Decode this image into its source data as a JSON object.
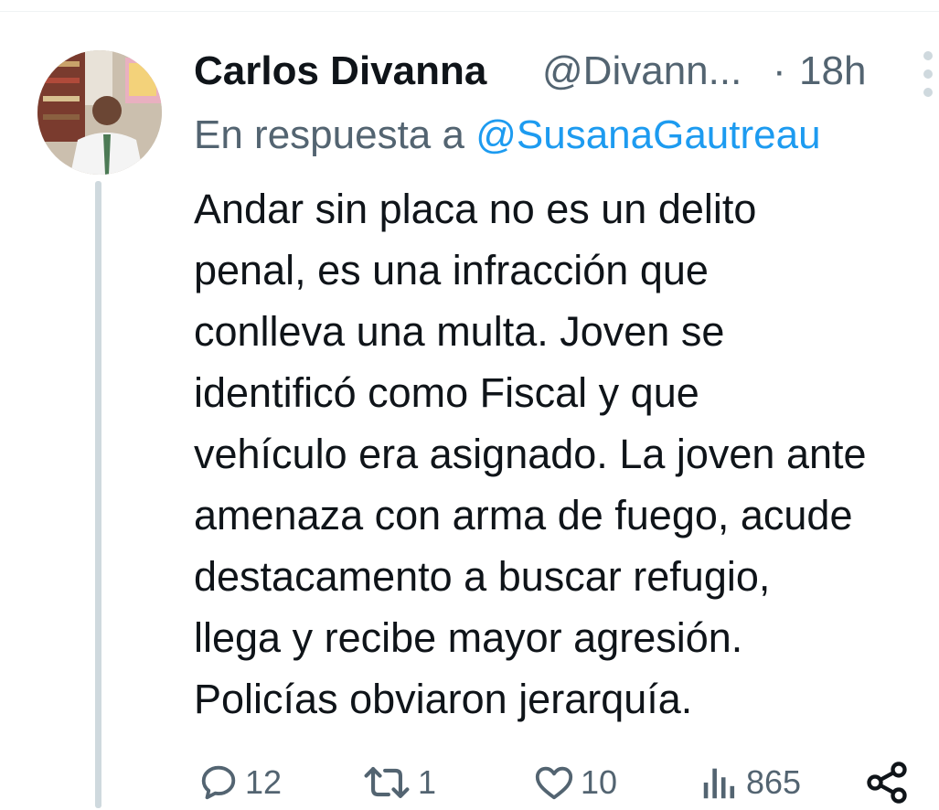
{
  "tweet": {
    "author_name": "Carlos Divanna",
    "handle": "@Divann...",
    "separator": "·",
    "time": "18h",
    "reply_prefix": "En respuesta a",
    "reply_to": "@SusanaGautreau",
    "text": "Andar sin placa no es un delito\npenal, es una infracción que\nconlleva una multa. Joven se\nidentificó como Fiscal y que\nvehículo era asignado. La joven ante\namenaza con arma de fuego, acude\ndestacamento a buscar refugio,\nllega y recibe mayor agresión.\nPolicías obviaron jerarquía."
  },
  "actions": {
    "replies": "12",
    "retweets": "1",
    "likes": "10",
    "views": "865"
  },
  "icons": [
    "more-icon",
    "reply-icon",
    "retweet-icon",
    "like-icon",
    "views-icon",
    "share-icon"
  ]
}
